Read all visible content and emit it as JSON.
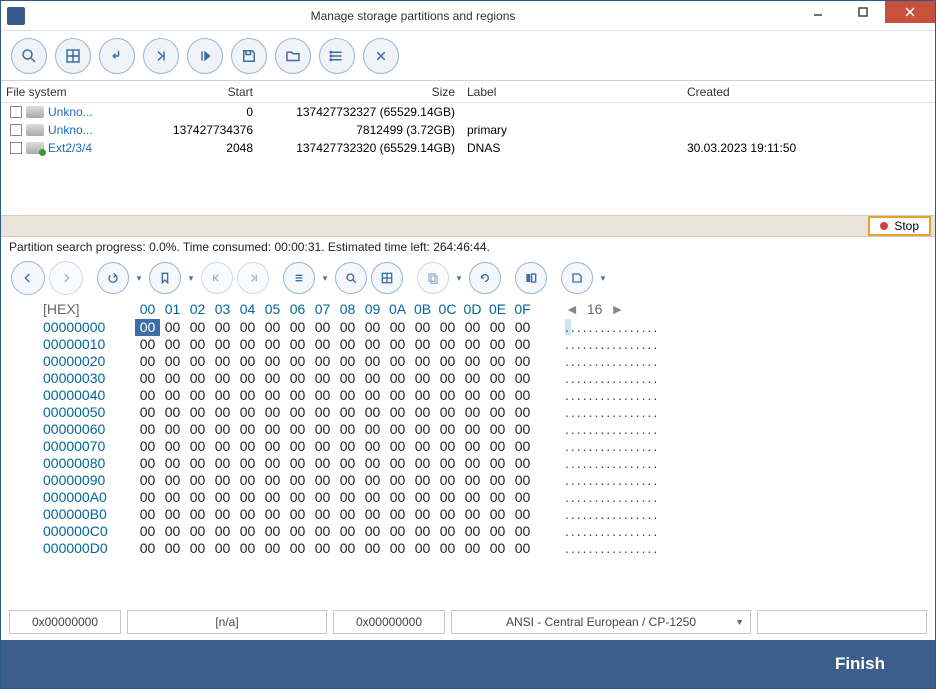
{
  "window": {
    "title": "Manage storage partitions and regions"
  },
  "table": {
    "headers": {
      "fs": "File system",
      "start": "Start",
      "size": "Size",
      "label": "Label",
      "created": "Created"
    },
    "rows": [
      {
        "fs": "Unkno...",
        "start": "0",
        "size": "137427732327 (65529.14GB)",
        "label": "",
        "created": "",
        "green": false
      },
      {
        "fs": "Unkno...",
        "start": "137427734376",
        "size": "7812499 (3.72GB)",
        "label": "primary",
        "created": "",
        "green": false
      },
      {
        "fs": "Ext2/3/4",
        "start": "2048",
        "size": "137427732320 (65529.14GB)",
        "label": "DNAS",
        "created": "30.03.2023 19:11:50",
        "green": true
      }
    ]
  },
  "stop": {
    "label": "Stop"
  },
  "progress": "Partition search progress: 0.0%. Time consumed: 00:00:31. Estimated time left: 264:46:44.",
  "hex": {
    "label": "[HEX]",
    "cols": [
      "00",
      "01",
      "02",
      "03",
      "04",
      "05",
      "06",
      "07",
      "08",
      "09",
      "0A",
      "0B",
      "0C",
      "0D",
      "0E",
      "0F"
    ],
    "width": "16",
    "rows": [
      "00000000",
      "00000010",
      "00000020",
      "00000030",
      "00000040",
      "00000050",
      "00000060",
      "00000070",
      "00000080",
      "00000090",
      "000000A0",
      "000000B0",
      "000000C0",
      "000000D0"
    ],
    "byte": "00",
    "ascii_row": "................"
  },
  "status": {
    "f1": "0x00000000",
    "f2": "[n/a]",
    "f3": "0x00000000",
    "f4": "ANSI - Central European / CP-1250"
  },
  "finish": "Finish"
}
